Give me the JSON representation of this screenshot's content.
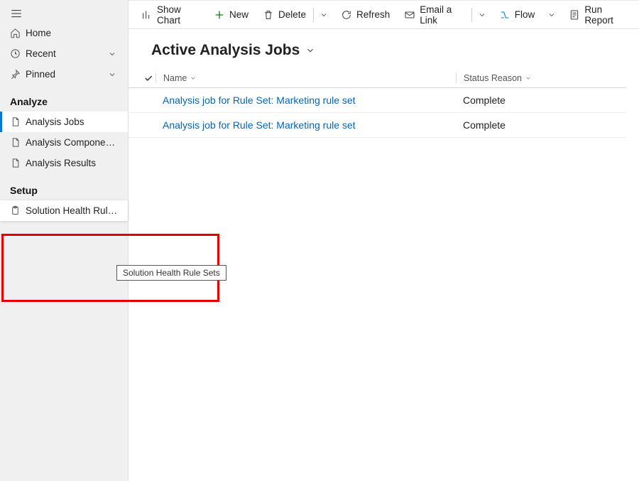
{
  "sidebar": {
    "nav": {
      "home": "Home",
      "recent": "Recent",
      "pinned": "Pinned"
    },
    "analyze": {
      "section": "Analyze",
      "jobs": "Analysis Jobs",
      "components": "Analysis Components",
      "results": "Analysis Results"
    },
    "setup": {
      "section": "Setup",
      "solution_health": "Solution Health Rule ...",
      "solution_health_tooltip": "Solution Health Rule Sets"
    }
  },
  "cmdbar": {
    "show_chart": "Show Chart",
    "new": "New",
    "delete": "Delete",
    "refresh": "Refresh",
    "email_link": "Email a Link",
    "flow": "Flow",
    "run_report": "Run Report"
  },
  "view": {
    "title": "Active Analysis Jobs",
    "columns": {
      "name": "Name",
      "status": "Status Reason"
    },
    "rows": [
      {
        "name": "Analysis job for Rule Set: Marketing rule set",
        "status": "Complete"
      },
      {
        "name": "Analysis job for Rule Set: Marketing rule set",
        "status": "Complete"
      }
    ]
  }
}
